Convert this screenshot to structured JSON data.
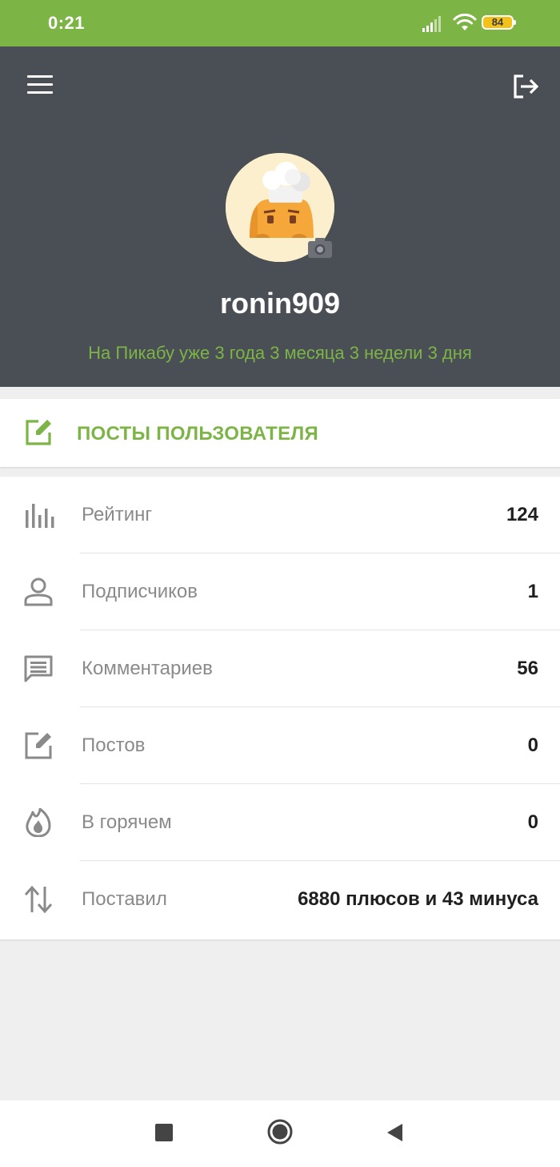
{
  "status_bar": {
    "time": "0:21",
    "battery": "84"
  },
  "profile": {
    "username": "ronin909",
    "since": "На Пикабу уже 3 года 3 месяца 3 недели 3 дня"
  },
  "posts_button": {
    "label": "ПОСТЫ ПОЛЬЗОВАТЕЛЯ"
  },
  "stats": [
    {
      "icon": "bar-chart-icon",
      "label": "Рейтинг",
      "value": "124"
    },
    {
      "icon": "person-icon",
      "label": "Подписчиков",
      "value": "1"
    },
    {
      "icon": "comment-icon",
      "label": "Комментариев",
      "value": "56"
    },
    {
      "icon": "edit-icon",
      "label": "Постов",
      "value": "0"
    },
    {
      "icon": "flame-icon",
      "label": "В горячем",
      "value": "0"
    },
    {
      "icon": "up-down-arrows-icon",
      "label": "Поставил",
      "value": "6880 плюсов и 43 минуса"
    }
  ],
  "colors": {
    "accent": "#7db446",
    "header_bg": "#4a4e55",
    "battery": "#f2c21a"
  }
}
